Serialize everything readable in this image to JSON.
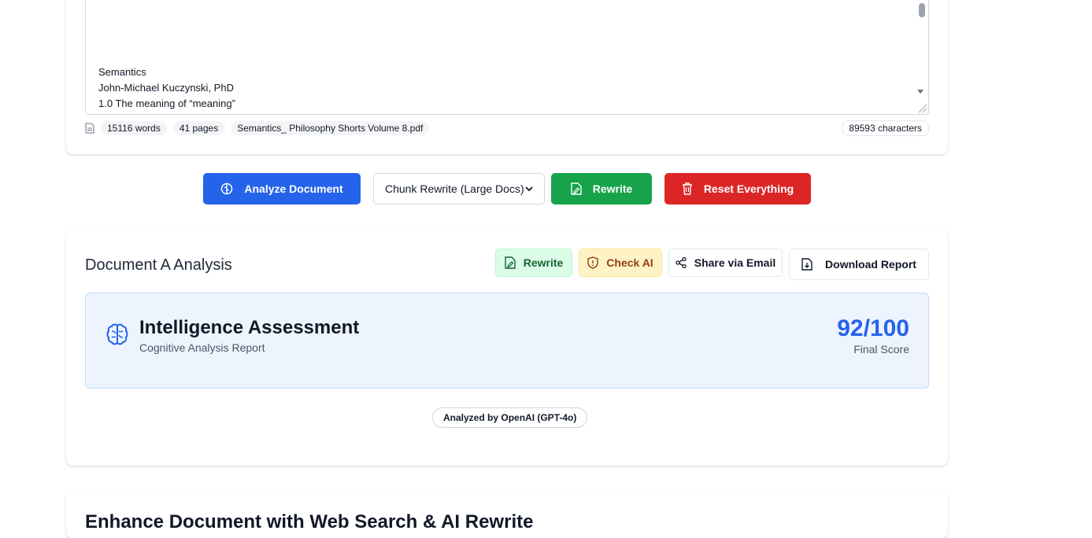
{
  "input_panel": {
    "text_lines": [
      "Semantics",
      "John-Michael Kuczynski, PhD",
      "1.0 The meaning of “meaning”"
    ],
    "words": "15116 words",
    "pages": "41 pages",
    "filename": "Semantics_ Philosophy Shorts Volume 8.pdf",
    "characters": "89593 characters"
  },
  "actions": {
    "analyze_label": "Analyze Document",
    "mode_selected": "Chunk Rewrite (Large Docs)",
    "rewrite_label": "Rewrite",
    "reset_label": "Reset Everything"
  },
  "analysis": {
    "title": "Document A Analysis",
    "rewrite_label": "Rewrite",
    "check_ai_label": "Check AI",
    "share_label": "Share via Email",
    "download_label": "Download Report",
    "assessment_title": "Intelligence Assessment",
    "assessment_subtitle": "Cognitive Analysis Report",
    "score": "92/100",
    "score_label": "Final Score",
    "analyzed_by": "Analyzed by OpenAI (GPT-4o)"
  },
  "next_section": {
    "title": "Enhance Document with Web Search & AI Rewrite"
  },
  "colors": {
    "primary": "#2563eb",
    "success": "#16a34a",
    "danger": "#dc2626"
  }
}
